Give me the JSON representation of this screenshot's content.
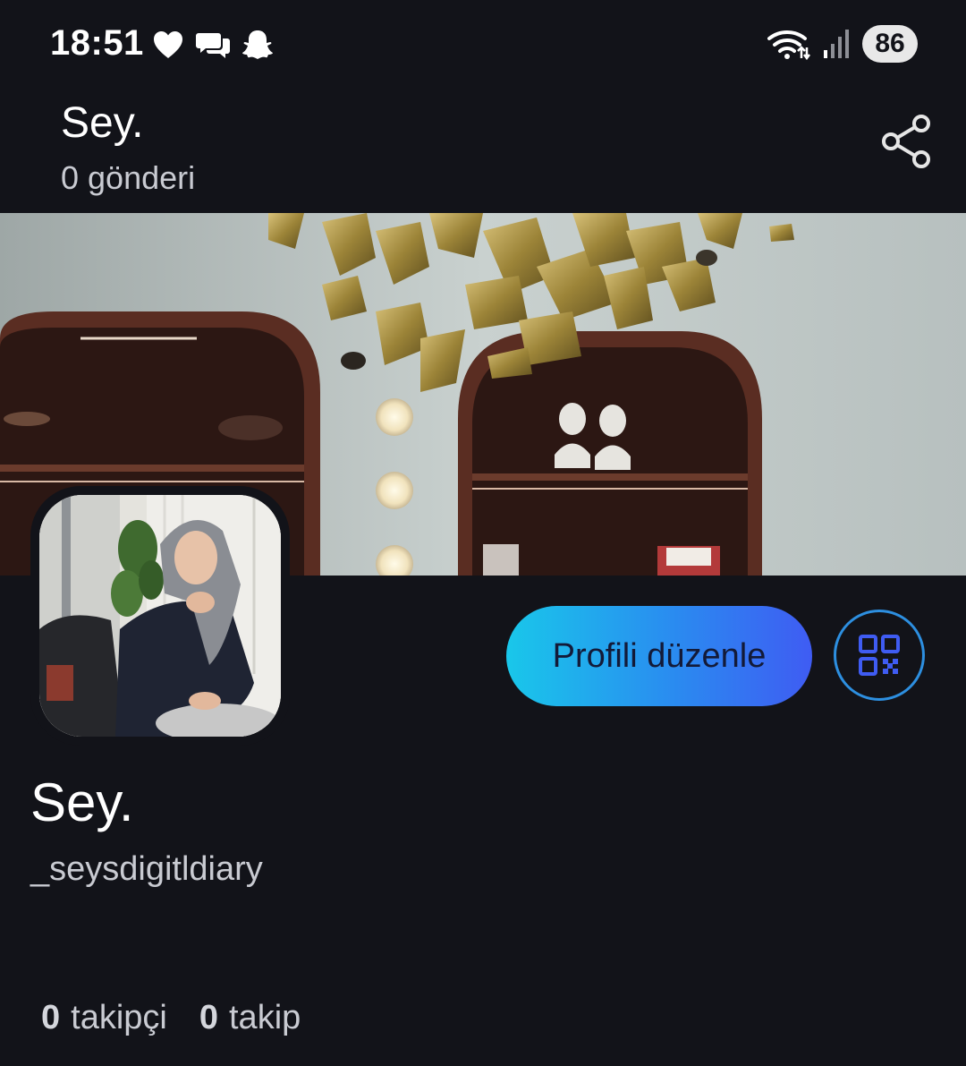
{
  "status_bar": {
    "time": "18:51",
    "battery": "86",
    "left_icons": [
      "heart-icon",
      "chat-bubbles-icon",
      "snapchat-ghost-icon"
    ],
    "right_icons": [
      "wifi-icon",
      "signal-icon",
      "battery-icon"
    ]
  },
  "header": {
    "title": "Sey.",
    "post_count": "0 gönderi",
    "share_icon": "share-icon"
  },
  "profile": {
    "display_name": "Sey.",
    "handle": "_seysdigitldiary",
    "edit_button_label": "Profili düzenle",
    "qr_icon": "qr-code-icon",
    "followers_count": "0",
    "followers_label": "takipçi",
    "following_count": "0",
    "following_label": "takip"
  },
  "colors": {
    "background": "#121319",
    "accent_gradient_start": "#19c7ea",
    "accent_gradient_end": "#3f5cf3",
    "secondary_text": "#c9cbd2"
  }
}
